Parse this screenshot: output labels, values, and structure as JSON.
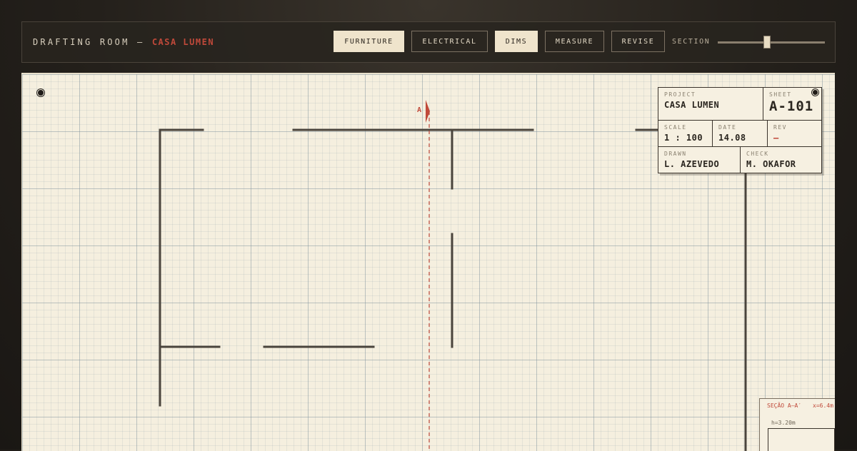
{
  "app": {
    "title": "DRAFTING ROOM —",
    "project_accent": "CASA LUMEN"
  },
  "toolbar": {
    "buttons": [
      {
        "label": "FURNITURE",
        "active": true
      },
      {
        "label": "ELECTRICAL",
        "active": false
      },
      {
        "label": "DIMS",
        "active": true
      },
      {
        "label": "MEASURE",
        "active": false
      },
      {
        "label": "REVISE",
        "active": false
      }
    ],
    "section_label": "SECTION",
    "section_slider_value": 0.46
  },
  "title_block": {
    "project_label": "PROJECT",
    "project_value": "CASA LUMEN",
    "sheet_label": "SHEET",
    "sheet_value": "A-101",
    "scale_label": "SCALE",
    "scale_value": "1 : 100",
    "date_label": "DATE",
    "date_value": "14.08",
    "rev_label": "REV",
    "rev_value": "—",
    "drawn_label": "DRAWN",
    "drawn_value": "L. AZEVEDO",
    "check_label": "CHECK",
    "check_value": "M. OKAFOR"
  },
  "section_cut": {
    "marker_label": "A"
  },
  "section_view": {
    "title": "SEÇÃO A–A′",
    "position": "x=6.4m",
    "height": "h=3.20m"
  },
  "colors": {
    "accent": "#c0493a",
    "paper": "#f5efdf",
    "ink": "#3a332b",
    "frame": "#24201b"
  }
}
